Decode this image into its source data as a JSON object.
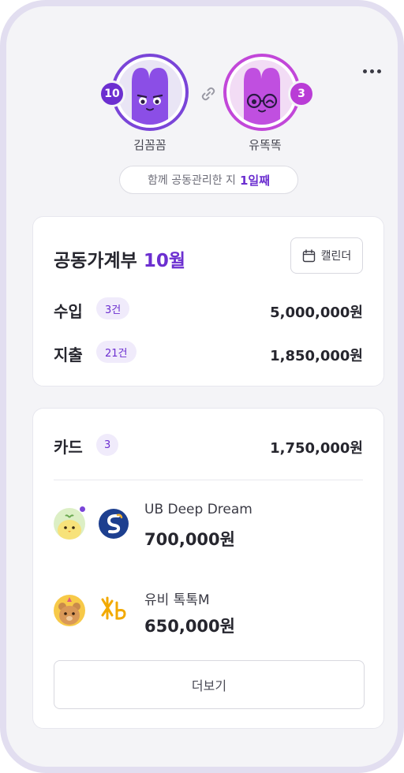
{
  "header": {
    "left_user": {
      "name": "김꼼꼼",
      "badge": "10"
    },
    "right_user": {
      "name": "유똑똑",
      "badge": "3"
    },
    "together_prefix": "함께 공동관리한 지",
    "together_days": "1일째"
  },
  "ledger": {
    "title": "공동가계부",
    "month": "10월",
    "calendar_label": "캘린더",
    "income": {
      "label": "수입",
      "count": "3건",
      "amount": "5,000,000원"
    },
    "expense": {
      "label": "지출",
      "count": "21건",
      "amount": "1,850,000원"
    }
  },
  "cards": {
    "label": "카드",
    "count": "3",
    "total": "1,750,000원",
    "items": [
      {
        "name": "UB Deep Dream",
        "amount": "700,000원"
      },
      {
        "name": "유비 톡톡M",
        "amount": "650,000원"
      }
    ],
    "more_label": "더보기"
  },
  "colors": {
    "accent": "#6c2fd0",
    "accent_pink": "#c247d9"
  }
}
